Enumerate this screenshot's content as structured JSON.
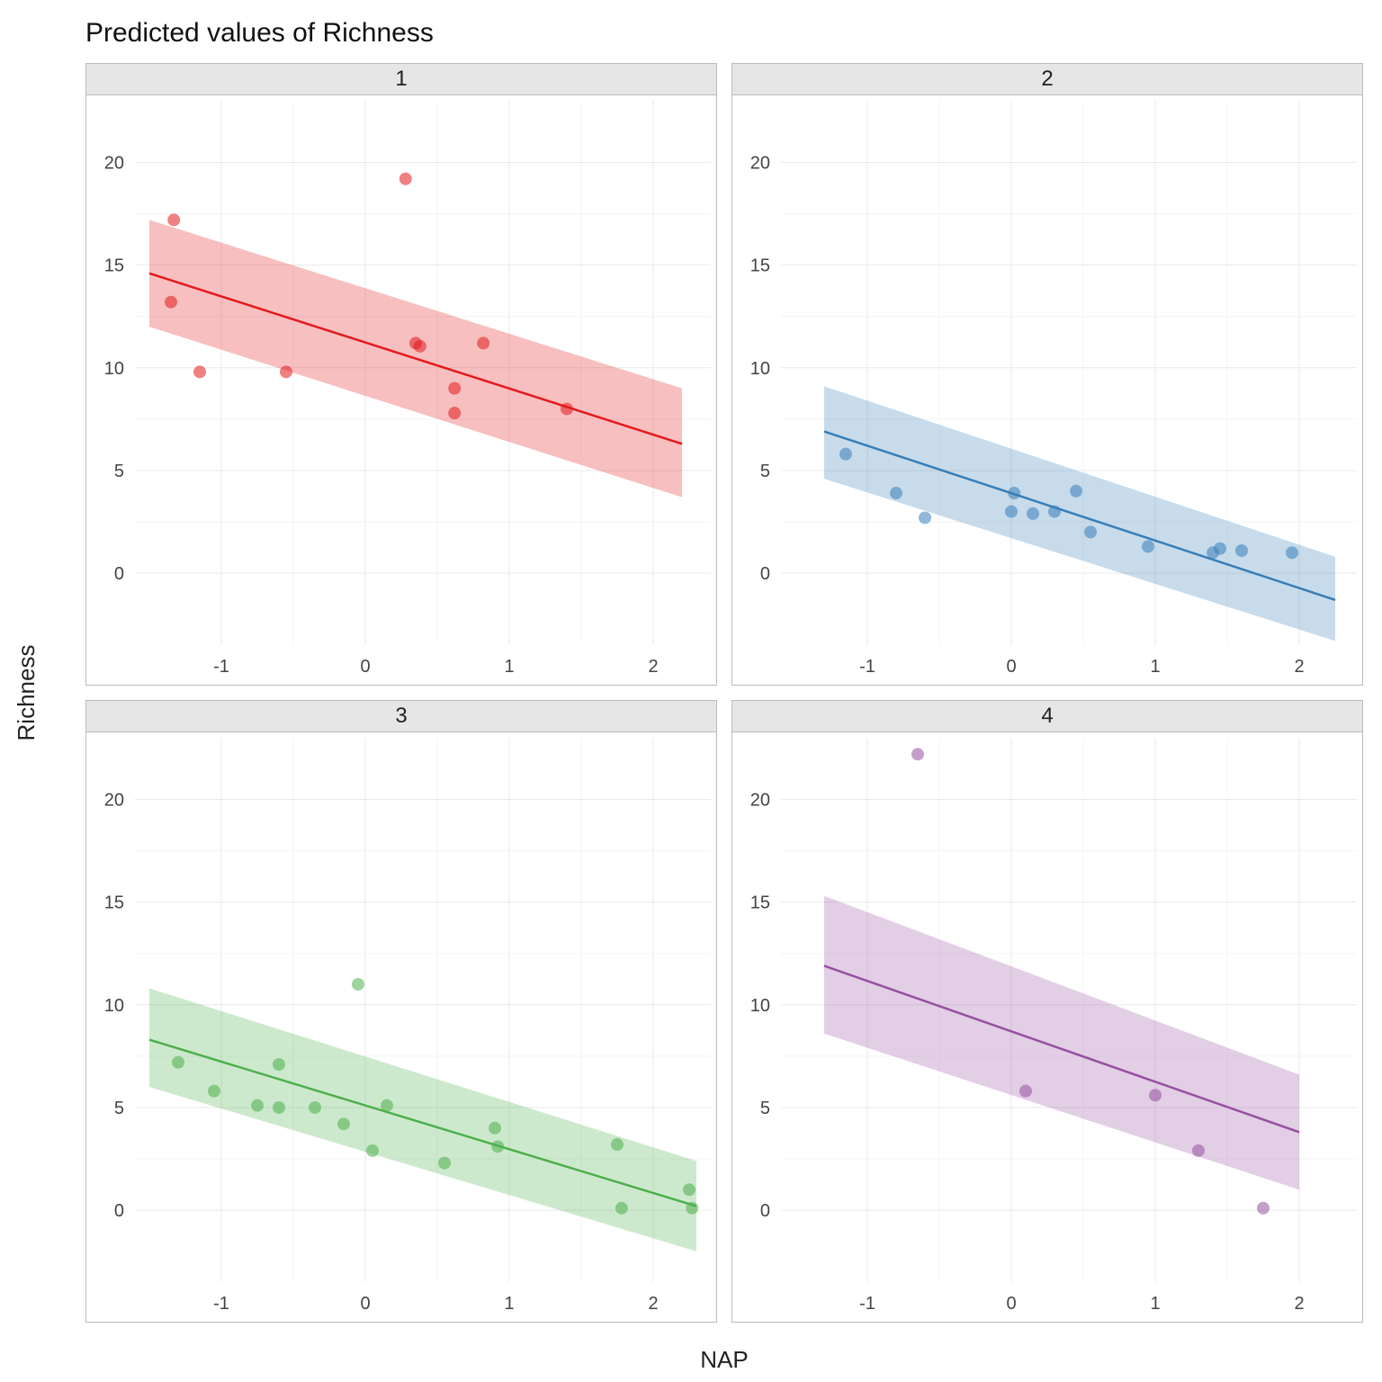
{
  "title": "Predicted values of Richness",
  "xlabel": "NAP",
  "ylabel": "Richness",
  "chart_data": {
    "type": "scatter",
    "facets": [
      "1",
      "2",
      "3",
      "4"
    ],
    "xlim": [
      -1.6,
      2.4
    ],
    "ylim": [
      -3.5,
      23
    ],
    "x_ticks": [
      -1,
      0,
      1,
      2
    ],
    "y_ticks": [
      0,
      5,
      10,
      15,
      20
    ],
    "colors": {
      "1": "#E41A1C",
      "2": "#377EB8",
      "3": "#4DAF4A",
      "4": "#984EA3"
    },
    "series": [
      {
        "facet": "1",
        "points": [
          {
            "x": -1.35,
            "y": 13.2
          },
          {
            "x": -1.33,
            "y": 17.2
          },
          {
            "x": -1.15,
            "y": 9.8
          },
          {
            "x": -0.55,
            "y": 9.8
          },
          {
            "x": 0.28,
            "y": 19.2
          },
          {
            "x": 0.35,
            "y": 11.2
          },
          {
            "x": 0.38,
            "y": 11.05
          },
          {
            "x": 0.62,
            "y": 9.0
          },
          {
            "x": 0.62,
            "y": 7.8
          },
          {
            "x": 0.82,
            "y": 11.2
          },
          {
            "x": 1.4,
            "y": 8.0
          }
        ],
        "fit": {
          "x": [
            -1.5,
            2.2
          ],
          "y": [
            14.6,
            6.3
          ]
        },
        "ribbon": {
          "x": [
            -1.5,
            2.2
          ],
          "ylo": [
            12.0,
            3.7
          ],
          "yhi": [
            17.2,
            9.0
          ]
        }
      },
      {
        "facet": "2",
        "points": [
          {
            "x": -1.15,
            "y": 5.8
          },
          {
            "x": -0.8,
            "y": 3.9
          },
          {
            "x": -0.6,
            "y": 2.7
          },
          {
            "x": 0.0,
            "y": 3.0
          },
          {
            "x": 0.02,
            "y": 3.9
          },
          {
            "x": 0.15,
            "y": 2.9
          },
          {
            "x": 0.3,
            "y": 3.0
          },
          {
            "x": 0.45,
            "y": 4.0
          },
          {
            "x": 0.55,
            "y": 2.0
          },
          {
            "x": 0.95,
            "y": 1.3
          },
          {
            "x": 1.4,
            "y": 1.0
          },
          {
            "x": 1.45,
            "y": 1.2
          },
          {
            "x": 1.6,
            "y": 1.1
          },
          {
            "x": 1.95,
            "y": 1.0
          }
        ],
        "fit": {
          "x": [
            -1.3,
            2.25
          ],
          "y": [
            6.9,
            -1.3
          ]
        },
        "ribbon": {
          "x": [
            -1.3,
            2.25
          ],
          "ylo": [
            4.6,
            -3.3
          ],
          "yhi": [
            9.1,
            0.8
          ]
        }
      },
      {
        "facet": "3",
        "points": [
          {
            "x": -1.3,
            "y": 7.2
          },
          {
            "x": -1.05,
            "y": 5.8
          },
          {
            "x": -0.75,
            "y": 5.1
          },
          {
            "x": -0.6,
            "y": 5.0
          },
          {
            "x": -0.6,
            "y": 7.1
          },
          {
            "x": -0.35,
            "y": 5.0
          },
          {
            "x": -0.15,
            "y": 4.2
          },
          {
            "x": -0.05,
            "y": 11.0
          },
          {
            "x": 0.05,
            "y": 2.9
          },
          {
            "x": 0.15,
            "y": 5.1
          },
          {
            "x": 0.55,
            "y": 2.3
          },
          {
            "x": 0.9,
            "y": 4.0
          },
          {
            "x": 0.92,
            "y": 3.1
          },
          {
            "x": 1.75,
            "y": 3.2
          },
          {
            "x": 1.78,
            "y": 0.1
          },
          {
            "x": 2.25,
            "y": 1.0
          },
          {
            "x": 2.27,
            "y": 0.1
          }
        ],
        "fit": {
          "x": [
            -1.5,
            2.3
          ],
          "y": [
            8.3,
            0.2
          ]
        },
        "ribbon": {
          "x": [
            -1.5,
            2.3
          ],
          "ylo": [
            6.0,
            -2.0
          ],
          "yhi": [
            10.8,
            2.4
          ]
        }
      },
      {
        "facet": "4",
        "points": [
          {
            "x": -0.65,
            "y": 22.2
          },
          {
            "x": 0.1,
            "y": 5.8
          },
          {
            "x": 1.0,
            "y": 5.6
          },
          {
            "x": 1.3,
            "y": 2.9
          },
          {
            "x": 1.75,
            "y": 0.1
          }
        ],
        "fit": {
          "x": [
            -1.3,
            2.0
          ],
          "y": [
            11.9,
            3.8
          ]
        },
        "ribbon": {
          "x": [
            -1.3,
            2.0
          ],
          "ylo": [
            8.6,
            1.0
          ],
          "yhi": [
            15.3,
            6.6
          ]
        }
      }
    ]
  }
}
